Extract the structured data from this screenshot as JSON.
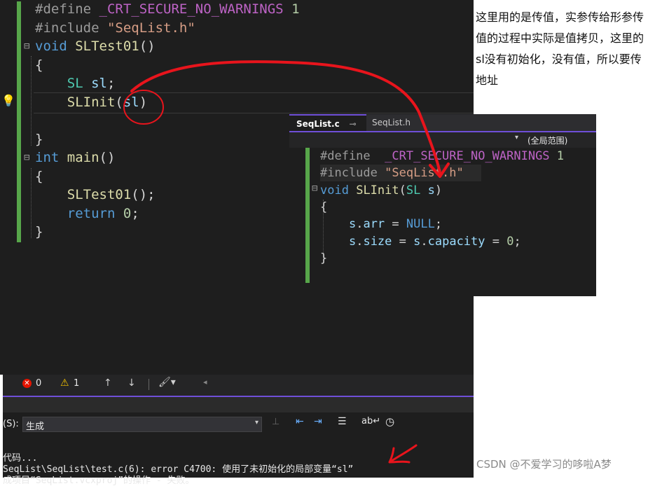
{
  "main_editor": {
    "lines": [
      {
        "parts": [
          [
            "pp",
            "#define "
          ],
          [
            "mac",
            "_CRT_SECURE_NO_WARNINGS"
          ],
          [
            "pl",
            " "
          ],
          [
            "num",
            "1"
          ]
        ]
      },
      {
        "parts": [
          [
            "pp",
            "#include "
          ],
          [
            "str",
            "\"SeqList.h\""
          ]
        ]
      },
      {
        "parts": [
          [
            "kw",
            "void"
          ],
          [
            "pl",
            " "
          ],
          [
            "fn",
            "SLTest01"
          ],
          [
            "pl",
            "()"
          ]
        ]
      },
      {
        "parts": [
          [
            "pl",
            "{"
          ]
        ]
      },
      {
        "parts": [
          [
            "pl",
            "    "
          ],
          [
            "ty",
            "SL"
          ],
          [
            "pl",
            " "
          ],
          [
            "id",
            "sl"
          ],
          [
            "pl",
            ";"
          ]
        ]
      },
      {
        "parts": [
          [
            "pl",
            "    "
          ],
          [
            "fn",
            "SLInit"
          ],
          [
            "pl",
            "("
          ],
          [
            "id",
            "sl"
          ],
          [
            "pl",
            ")"
          ]
        ]
      },
      {
        "parts": [
          [
            "pl",
            ""
          ]
        ]
      },
      {
        "parts": [
          [
            "pl",
            "}"
          ]
        ]
      },
      {
        "parts": [
          [
            "kw",
            "int"
          ],
          [
            "pl",
            " "
          ],
          [
            "fn",
            "main"
          ],
          [
            "pl",
            "()"
          ]
        ]
      },
      {
        "parts": [
          [
            "pl",
            "{"
          ]
        ]
      },
      {
        "parts": [
          [
            "pl",
            "    "
          ],
          [
            "fn",
            "SLTest01"
          ],
          [
            "pl",
            "();"
          ]
        ]
      },
      {
        "parts": [
          [
            "pl",
            "    "
          ],
          [
            "kw",
            "return"
          ],
          [
            "pl",
            " "
          ],
          [
            "num",
            "0"
          ],
          [
            "pl",
            ";"
          ]
        ]
      },
      {
        "parts": [
          [
            "pl",
            "}"
          ]
        ]
      }
    ]
  },
  "note": "这里用的是传值，实参传给形参传值的过程中实际是值拷贝，这里的sl没有初始化，没有值，所以要传地址",
  "secondary_editor": {
    "tab_active": "SeqList.c",
    "tab_inactive": "SeqList.h",
    "scope": "(全局范围)",
    "lines": [
      {
        "parts": [
          [
            "pp",
            "#define "
          ],
          [
            "pl",
            " "
          ],
          [
            "mac",
            "_CRT_SECURE_NO_WARNINGS"
          ],
          [
            "pl",
            " "
          ],
          [
            "num",
            "1"
          ]
        ]
      },
      {
        "parts": [
          [
            "pp",
            "#include "
          ],
          [
            "str",
            "\"SeqList.h\""
          ]
        ]
      },
      {
        "parts": [
          [
            "kw",
            "void"
          ],
          [
            "pl",
            " "
          ],
          [
            "fn",
            "SLInit"
          ],
          [
            "pl",
            "("
          ],
          [
            "ty",
            "SL"
          ],
          [
            "pl",
            " "
          ],
          [
            "id",
            "s"
          ],
          [
            "pl",
            ")"
          ]
        ]
      },
      {
        "parts": [
          [
            "pl",
            "{"
          ]
        ]
      },
      {
        "parts": [
          [
            "pl",
            "    "
          ],
          [
            "id",
            "s"
          ],
          [
            "pl",
            "."
          ],
          [
            "id",
            "arr"
          ],
          [
            "pl",
            " = "
          ],
          [
            "kw",
            "NULL"
          ],
          [
            "pl",
            ";"
          ]
        ]
      },
      {
        "parts": [
          [
            "pl",
            "    "
          ],
          [
            "id",
            "s"
          ],
          [
            "pl",
            "."
          ],
          [
            "id",
            "size"
          ],
          [
            "pl",
            " = "
          ],
          [
            "id",
            "s"
          ],
          [
            "pl",
            "."
          ],
          [
            "id",
            "capacity"
          ],
          [
            "pl",
            " = "
          ],
          [
            "num",
            "0"
          ],
          [
            "pl",
            ";"
          ]
        ]
      },
      {
        "parts": [
          [
            "pl",
            "}"
          ]
        ]
      }
    ]
  },
  "status": {
    "errors": "0",
    "warnings": "1"
  },
  "output": {
    "source_label": "(S):",
    "source_value": "生成",
    "lines": [
      "代码...",
      "SeqList\\SeqList\\test.c(6): error C4700: 使用了未初始化的局部变量“sl”",
      "成项目“SeqList.vcxproj”的操作 - 失败。"
    ]
  },
  "watermark": "CSDN @不爱学习的哆啦A梦",
  "colors": {
    "annotation_red": "#e8141c",
    "accent_purple": "#6f4fd8",
    "change_bar_green": "#57a64a"
  }
}
